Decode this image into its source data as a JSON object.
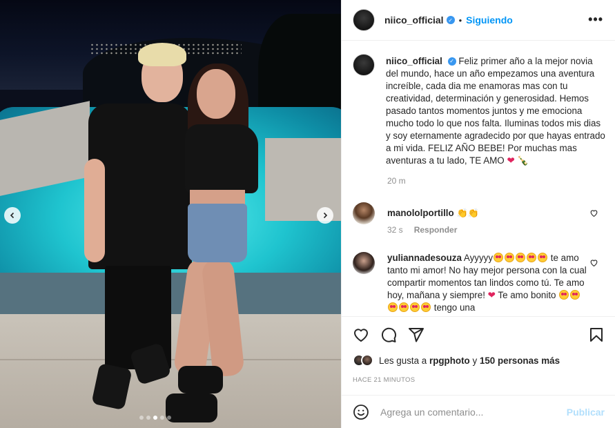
{
  "post": {
    "username": "niico_official",
    "follow_status": "Siguiendo",
    "more_glyph": "•••",
    "separator": "•"
  },
  "caption": {
    "username": "niico_official",
    "text": "Feliz primer año a la mejor novia del mundo, hace un año empezamos una aventura increíble, cada dia me enamoras mas con tu creatividad, determinación y generosidad. Hemos pasado tantos momentos juntos y me emociona mucho todo lo que nos falta. Iluminas todos mis dias y soy eternamente agradecido por que hayas entrado a mi vida. FELIZ AÑO BEBE! Por muchas mas aventuras a tu lado, TE AMO",
    "emojis_end": [
      "red-heart",
      "champagne"
    ],
    "time": "20 m"
  },
  "comments": [
    {
      "username": "manololportillo",
      "emojis": [
        "clapping-hands",
        "clapping-hands"
      ],
      "time": "32 s",
      "reply_label": "Responder"
    },
    {
      "username": "yuliannadesouza",
      "text_a": "Ayyyyy",
      "text_b": "te amo tanto mi amor! No hay mejor persona con la cual compartir momentos tan lindos como tú. Te amo hoy, mañana y siempre!",
      "text_c": "Te amo bonito",
      "text_d": "tengo una",
      "emojis": [
        "star-struck",
        "star-struck",
        "star-struck",
        "star-struck",
        "star-struck",
        "red-heart"
      ]
    }
  ],
  "actions": {
    "icons": [
      "heart-icon",
      "comment-icon",
      "share-icon",
      "bookmark-icon"
    ]
  },
  "likes": {
    "prefix": "Les gusta a",
    "first_user": "rpgphoto",
    "connector": "y",
    "others": "150 personas más"
  },
  "posted_ago": "HACE 21 MINUTOS",
  "comment_input": {
    "placeholder": "Agrega un comentario...",
    "publish_label": "Publicar"
  },
  "carousel": {
    "total_slides": 5,
    "active_slide": 3
  },
  "colors": {
    "link_blue": "#0095f6",
    "verified_blue": "#3897f0",
    "publish_disabled": "#b2dffc",
    "muted_text": "#8e8e8e"
  }
}
